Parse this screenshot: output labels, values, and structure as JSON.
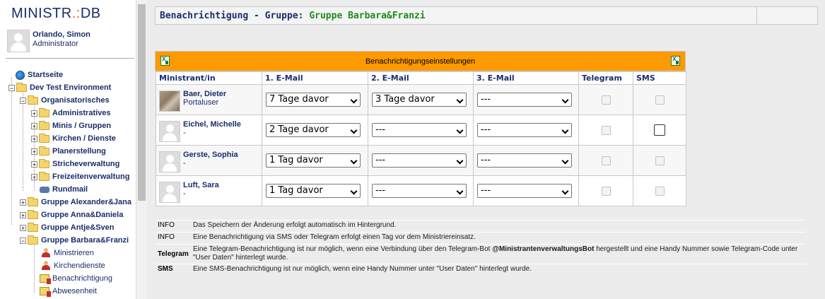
{
  "sidebar": {
    "logo_left": "MINISTR",
    "logo_sep": ".:",
    "logo_right": "DB",
    "user_name": "Orlando, Simon",
    "user_role": "Administrator",
    "tree": [
      {
        "label": "Startseite",
        "icon": "globe-icon"
      },
      {
        "label": "Dev Test Environment",
        "icon": "folder-icon"
      },
      {
        "label": "Organisatorisches",
        "icon": "folder-icon"
      },
      {
        "label": "Administratives",
        "icon": "folder-icon"
      },
      {
        "label": "Minis / Gruppen",
        "icon": "folder-icon"
      },
      {
        "label": "Kirchen / Dienste",
        "icon": "folder-icon"
      },
      {
        "label": "Planerstellung",
        "icon": "folder-icon"
      },
      {
        "label": "Stricheverwaltung",
        "icon": "folder-icon"
      },
      {
        "label": "Freizeitenverwaltung",
        "icon": "folder-icon"
      },
      {
        "label": "Rundmail",
        "icon": "mail-icon"
      },
      {
        "label": "Gruppe Alexander&Jana",
        "icon": "folder-icon"
      },
      {
        "label": "Gruppe Anna&Daniela",
        "icon": "folder-icon"
      },
      {
        "label": "Gruppe Antje&Sven",
        "icon": "folder-icon"
      },
      {
        "label": "Gruppe Barbara&Franzi",
        "icon": "folder-icon"
      },
      {
        "label": "Ministrieren",
        "icon": "person-icon"
      },
      {
        "label": "Kirchendienste",
        "icon": "person-icon"
      },
      {
        "label": "Benachrichtigung",
        "icon": "notification-icon"
      },
      {
        "label": "Abwesenheit",
        "icon": "notification-icon"
      }
    ]
  },
  "header": {
    "title_prefix": "Benachrichtigung - Gruppe: ",
    "group": "Gruppe Barbara&Franzi"
  },
  "notifications": {
    "title": "Benachrichtigungseinstellungen",
    "columns": [
      "Ministrant/in",
      "1. E-Mail",
      "2. E-Mail",
      "3. E-Mail",
      "Telegram",
      "SMS"
    ],
    "rows": [
      {
        "name": "Baer, Dieter",
        "sub": "Portaluser",
        "email1": "7 Tage davor",
        "email2": "3 Tage davor",
        "email3": "---",
        "telegram": false,
        "sms": false
      },
      {
        "name": "Eichel, Michelle",
        "sub": "-",
        "email1": "2 Tage davor",
        "email2": "---",
        "email3": "---",
        "telegram": false,
        "sms": false
      },
      {
        "name": "Gerste, Sophia",
        "sub": "-",
        "email1": "1 Tag davor",
        "email2": "---",
        "email3": "---",
        "telegram": false,
        "sms": false
      },
      {
        "name": "Luft, Sara",
        "sub": "-",
        "email1": "1 Tag davor",
        "email2": "---",
        "email3": "---",
        "telegram": false,
        "sms": false
      }
    ]
  },
  "info": [
    {
      "label": "INFO",
      "text": "Das Speichern der Änderung erfolgt automatisch im Hintergrund."
    },
    {
      "label": "INFO",
      "text": "Eine Benachrichtigung via SMS oder Telegram erfolgt einen Tag vor dem Ministriereinsatz."
    },
    {
      "label": "Telegram",
      "text_a": "Eine Telegram-Benachrichtigung ist nur möglich, wenn eine Verbindung über den Telegram-Bot ",
      "bot": "@MinistrantenverwaltungsBot",
      "text_b": " hergestellt und eine Handy Nummer sowie Telegram-Code unter \"User Daten\" hinterlegt wurde."
    },
    {
      "label": "SMS",
      "text": "Eine SMS-Benachrichtigung ist nur möglich, wenn eine Handy Nummer unter \"User Daten\" hinterlegt wurde."
    }
  ]
}
